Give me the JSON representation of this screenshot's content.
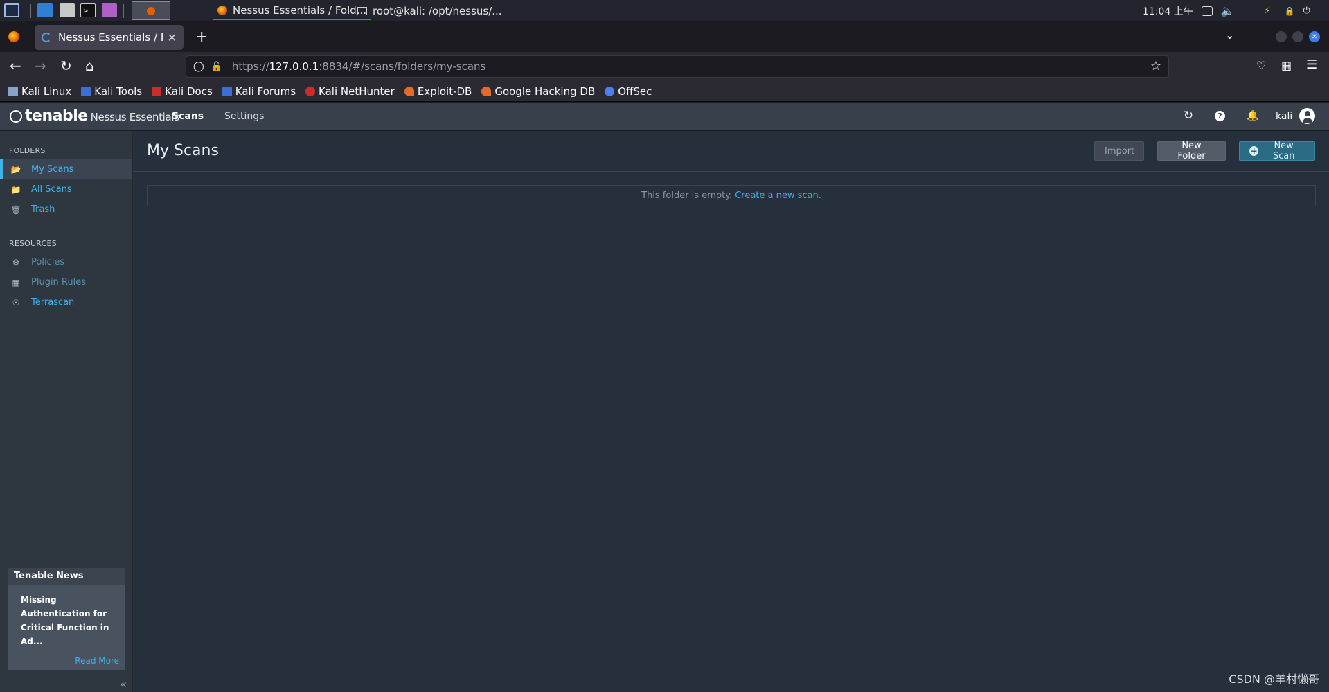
{
  "taskbar": {
    "tasks": [
      {
        "label": "Nessus Essentials / Fold..."
      },
      {
        "label": "root@kali: /opt/nessus/..."
      }
    ],
    "clock": "11:04 上午"
  },
  "browser": {
    "tab_title": "Nessus Essentials / Folde",
    "new_tab": "+",
    "url_prefix": "https://",
    "url_host": "127.0.0.1",
    "url_rest": ":8834/#/scans/folders/my-scans"
  },
  "bookmarks": [
    {
      "label": "Kali Linux",
      "color": "#1e1e1e"
    },
    {
      "label": "Kali Tools",
      "color": "#3a6fd8"
    },
    {
      "label": "Kali Docs",
      "color": "#d02b2b"
    },
    {
      "label": "Kali Forums",
      "color": "#3a6fd8"
    },
    {
      "label": "Kali NetHunter",
      "color": "#d02b2b"
    },
    {
      "label": "Exploit-DB",
      "color": "#e8672a"
    },
    {
      "label": "Google Hacking DB",
      "color": "#e8672a"
    },
    {
      "label": "OffSec",
      "color": "#4d7df0"
    }
  ],
  "app": {
    "brand": "tenable",
    "product": "Nessus Essentials",
    "nav": {
      "scans": "Scans",
      "settings": "Settings"
    },
    "user": "kali"
  },
  "sidebar": {
    "folders_heading": "FOLDERS",
    "folders": [
      {
        "label": "My Scans",
        "icon": "folder-open-icon"
      },
      {
        "label": "All Scans",
        "icon": "folder-icon"
      },
      {
        "label": "Trash",
        "icon": "trash-icon"
      }
    ],
    "resources_heading": "RESOURCES",
    "resources": [
      {
        "label": "Policies",
        "icon": "policy-icon"
      },
      {
        "label": "Plugin Rules",
        "icon": "plugin-rules-icon"
      },
      {
        "label": "Terrascan",
        "icon": "terrascan-icon"
      }
    ],
    "news": {
      "heading": "Tenable News",
      "body": "Missing Authentication for Critical Function in Ad...",
      "more": "Read More"
    }
  },
  "main": {
    "title": "My Scans",
    "buttons": {
      "import": "Import",
      "new_folder": "New Folder",
      "new_scan": "New Scan"
    },
    "empty_text": "This folder is empty.",
    "empty_link": "Create a new scan."
  },
  "watermark": "CSDN @羊村懒哥",
  "colors": {
    "accent": "#3fb2e8",
    "header": "#37404b",
    "sidebar": "#2e3640",
    "main": "#26303d"
  }
}
